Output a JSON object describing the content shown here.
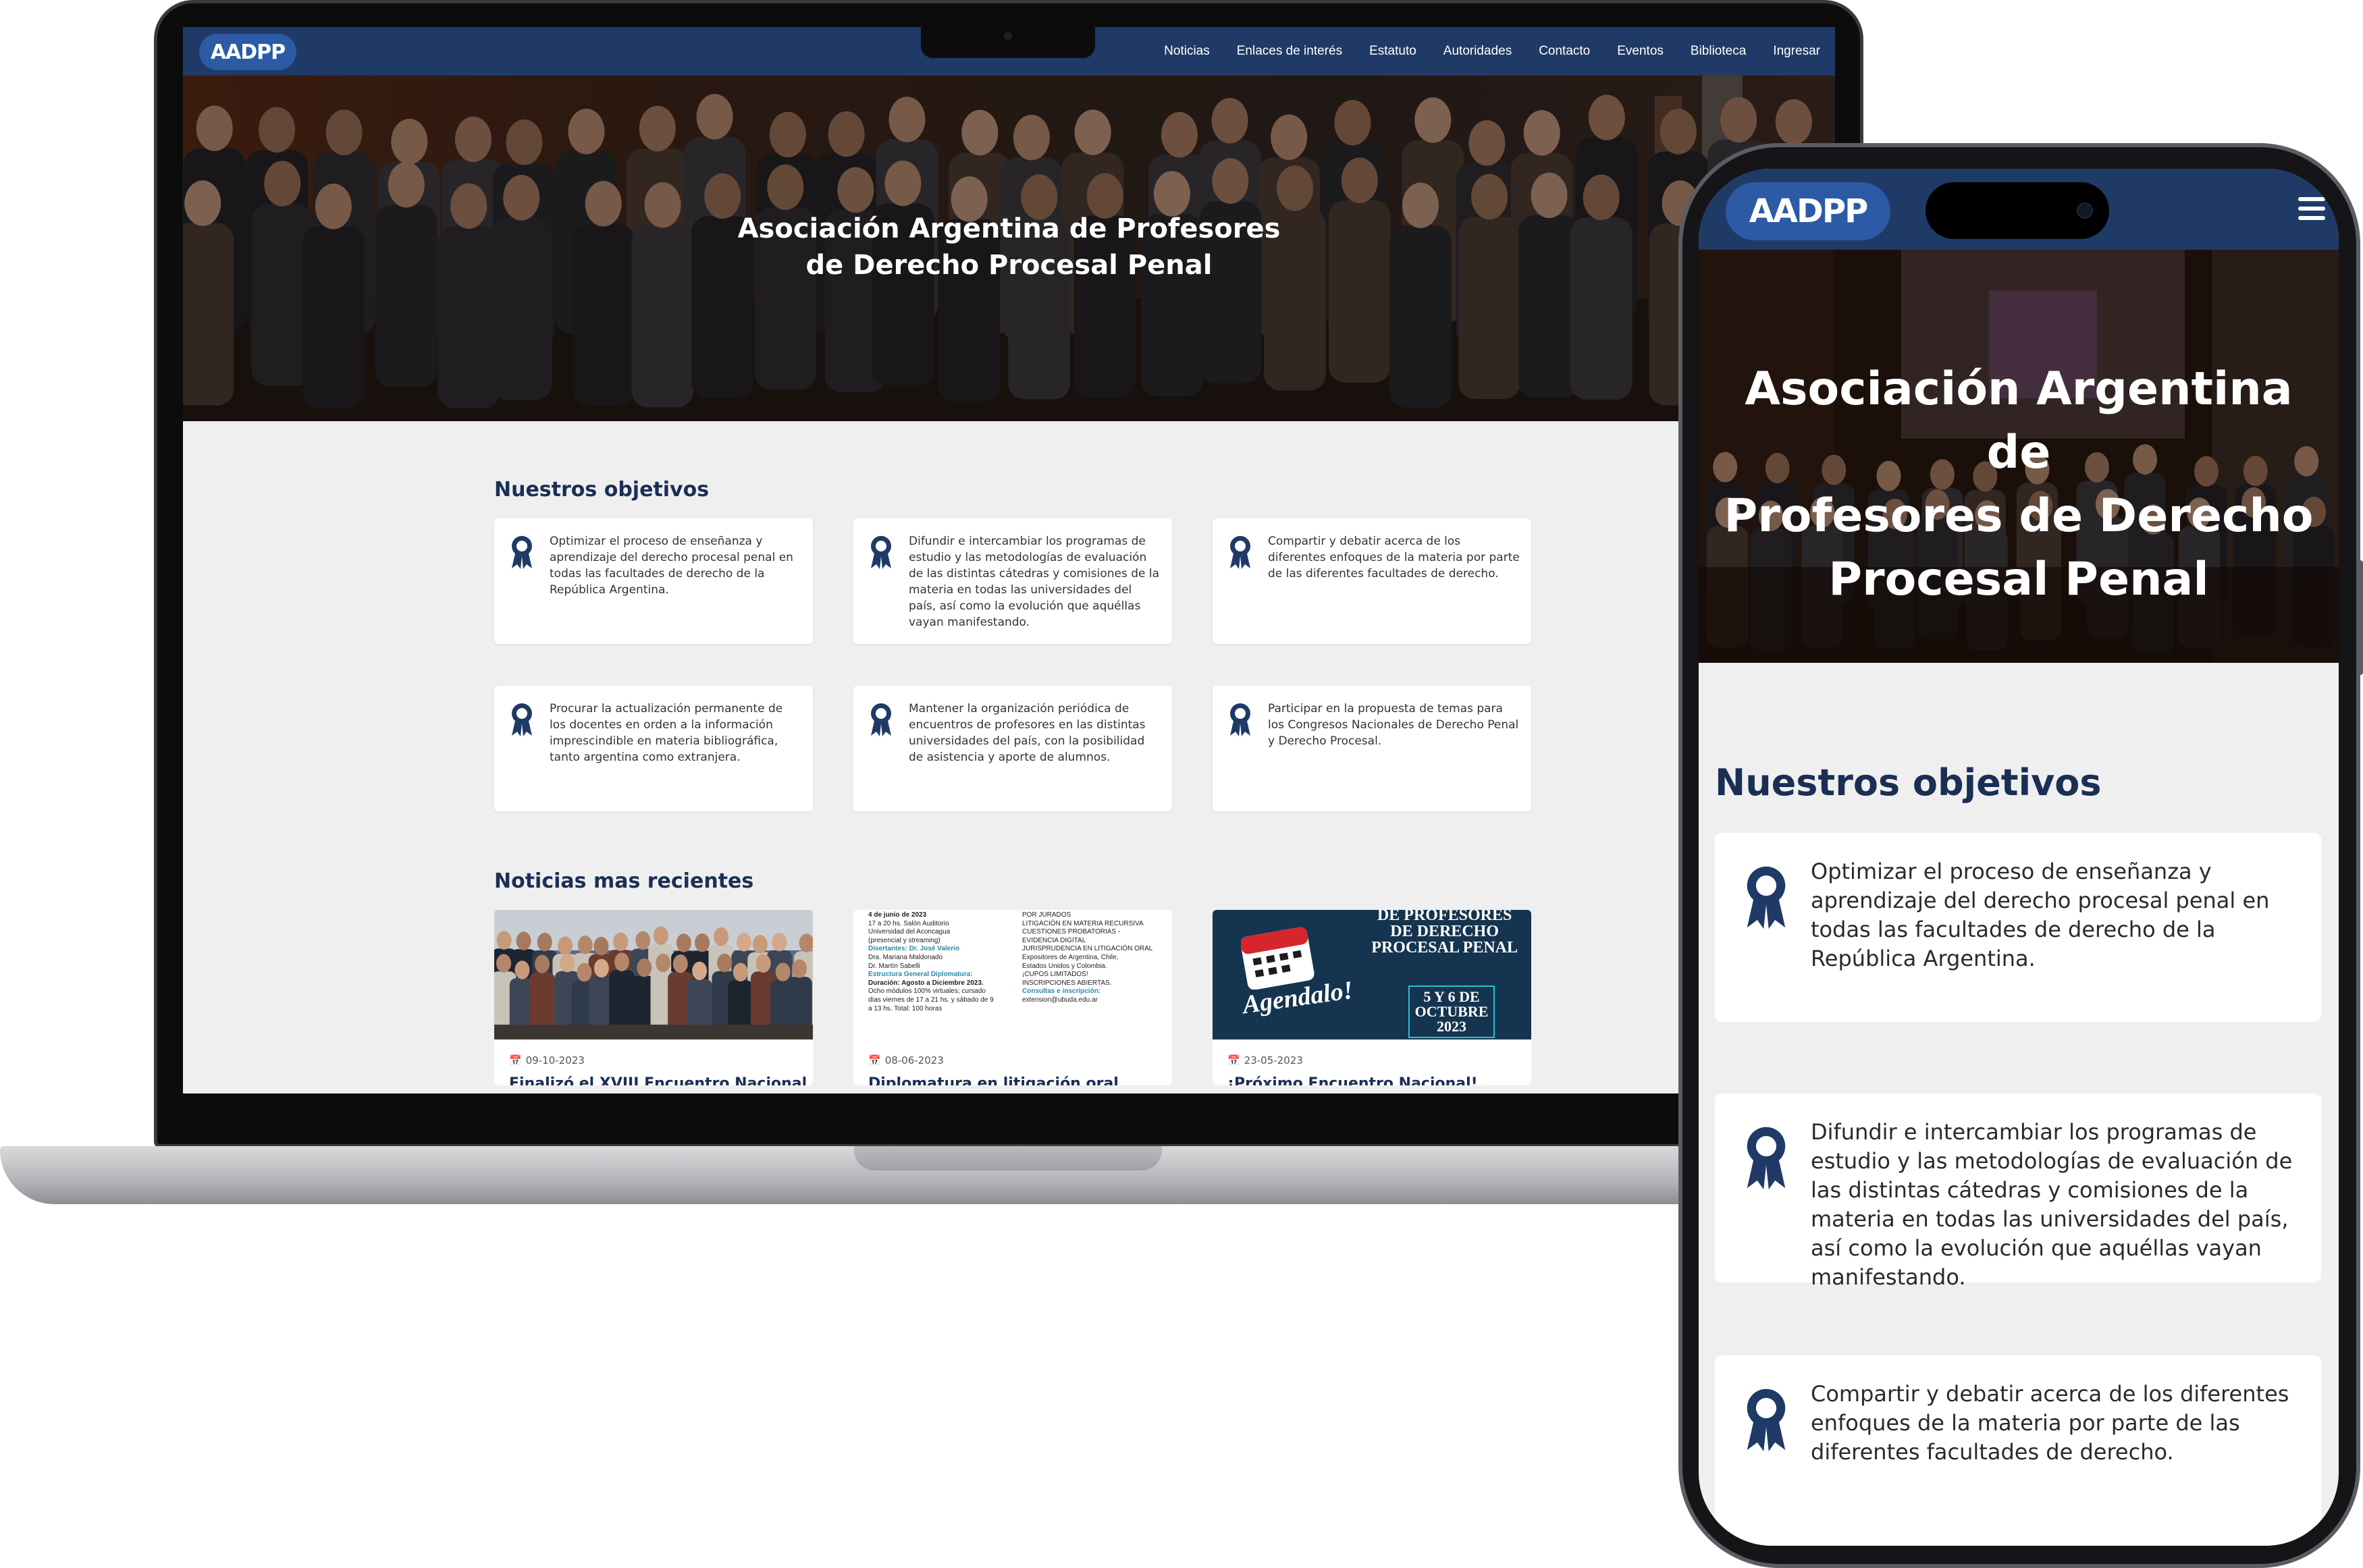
{
  "brand": {
    "logo_text": "AADPP",
    "primary_color": "#1f3a66",
    "accent_color": "#2c5aa5"
  },
  "nav": {
    "items": [
      "Noticias",
      "Enlaces de interés",
      "Estatuto",
      "Autoridades",
      "Contacto",
      "Eventos",
      "Biblioteca",
      "Ingresar"
    ]
  },
  "hero": {
    "title_line1": "Asociación Argentina de Profesores",
    "title_line2": "de Derecho Procesal Penal",
    "mobile_title_line1": "Asociación Argentina de",
    "mobile_title_line2": "Profesores de Derecho",
    "mobile_title_line3": "Procesal Penal"
  },
  "objectives": {
    "heading": "Nuestros objetivos",
    "items": [
      {
        "icon": "award-ribbon-icon",
        "text": "Optimizar el proceso de enseñanza y aprendizaje del derecho procesal penal en todas las facultades de derecho de la República Argentina."
      },
      {
        "icon": "award-ribbon-icon",
        "text": "Difundir e intercambiar los programas de estudio y las metodologías de evaluación de las distintas cátedras y comisiones de la materia en todas las universidades del país, así como la evolución que aquéllas vayan manifestando."
      },
      {
        "icon": "award-ribbon-icon",
        "text": "Compartir y debatir acerca de los diferentes enfoques de la materia por parte de las diferentes facultades de derecho."
      },
      {
        "icon": "award-ribbon-icon",
        "text": "Procurar la actualización permanente de los docentes en orden a la información imprescindible en materia bibliográfica, tanto argentina como extranjera."
      },
      {
        "icon": "award-ribbon-icon",
        "text": "Mantener la organización periódica de encuentros de profesores en las distintas universidades del país, con la posibilidad de asistencia y aporte de alumnos."
      },
      {
        "icon": "award-ribbon-icon",
        "text": "Participar en la propuesta de temas para los Congresos Nacionales de Derecho Penal y Derecho Procesal."
      }
    ]
  },
  "news": {
    "heading": "Noticias mas recientes",
    "items": [
      {
        "date": "09-10-2023",
        "title": "Finalizó el XVIII Encuentro Nacional"
      },
      {
        "date": "08-06-2023",
        "title": "Diplomatura en litigación oral"
      },
      {
        "date": "23-05-2023",
        "title": "¡Próximo Encuentro Nacional!"
      }
    ],
    "flyer_left": [
      "4 de junio de 2023",
      "17 a 20 hs. Salón Auditorio",
      "Universidad del Aconcagua",
      "(presencial y streaming)",
      "Disertantes: Dr. José Valerio",
      "Dra. Mariana Maldonado",
      "Dr. Martín Sabelli",
      "Estructura General Diplomatura:",
      "Duración: Agosto a Diciembre 2023.",
      "Ocho módulos 100% virtuales; cursado",
      "días viernes de 17 a 21 hs. y sábado de 9",
      "a 13 hs. Total: 100 horas"
    ],
    "flyer_right": [
      "POR JURADOS",
      "LITIGACIÓN EN MATERIA RECURSIVA",
      "CUESTIONES PROBATORIAS -",
      "EVIDENCIA DIGITAL",
      "JURISPRUDENCIA EN LITIGACIÓN ORAL",
      "Expositores de Argentina, Chile,",
      "Estados Unidos y Colombia.",
      "¡CUPOS LIMITADOS!",
      "INSCRIPCIONES ABIERTAS.",
      "Consultas e inscripción:",
      "extension@ubuda.edu.ar"
    ],
    "event_banner": {
      "line1": "DE PROFESORES",
      "line2": "DE DERECHO",
      "line3": "PROCESAL PENAL",
      "agendalo": "Agendalo!",
      "dates1": "5 Y 6 DE",
      "dates2": "OCTUBRE",
      "year": "2023"
    }
  }
}
